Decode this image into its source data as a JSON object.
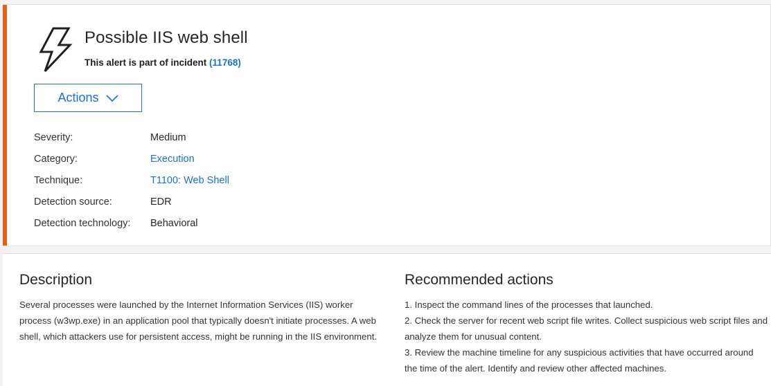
{
  "alert": {
    "title": "Possible IIS web shell",
    "incident_prefix": "This alert is part of incident",
    "incident_link": "(11768)",
    "icon": "lightning-bolt-icon"
  },
  "actions": {
    "label": "Actions",
    "icon": "chevron-down-icon"
  },
  "properties": [
    {
      "label": "Severity:",
      "value": "Medium"
    },
    {
      "label": "Category:",
      "value": "Execution"
    },
    {
      "label": "Technique:",
      "value": "T1100: Web Shell"
    },
    {
      "label": "Detection source:",
      "value": "EDR"
    },
    {
      "label": "Detection technology:",
      "value": "Behavioral"
    }
  ],
  "description": {
    "title": "Description",
    "text": "Several processes were launched by the Internet Information Services (IIS) worker process (w3wp.exe) in an application pool that typically doesn't initiate processes. A web shell, which attackers use for persistent access, might be running in the IIS environment."
  },
  "recommended": {
    "title": "Recommended actions",
    "items": [
      "1. Inspect the command lines of the processes that launched.",
      "2. Check the server for recent web script file writes. Collect suspicious web script files and analyze them for unusual content.",
      "3. Review the machine timeline for any suspicious activities that have occurred around the time of the alert. Identify and review other affected machines."
    ]
  },
  "colors": {
    "accent": "#e8611a",
    "link": "#1a73c8"
  }
}
